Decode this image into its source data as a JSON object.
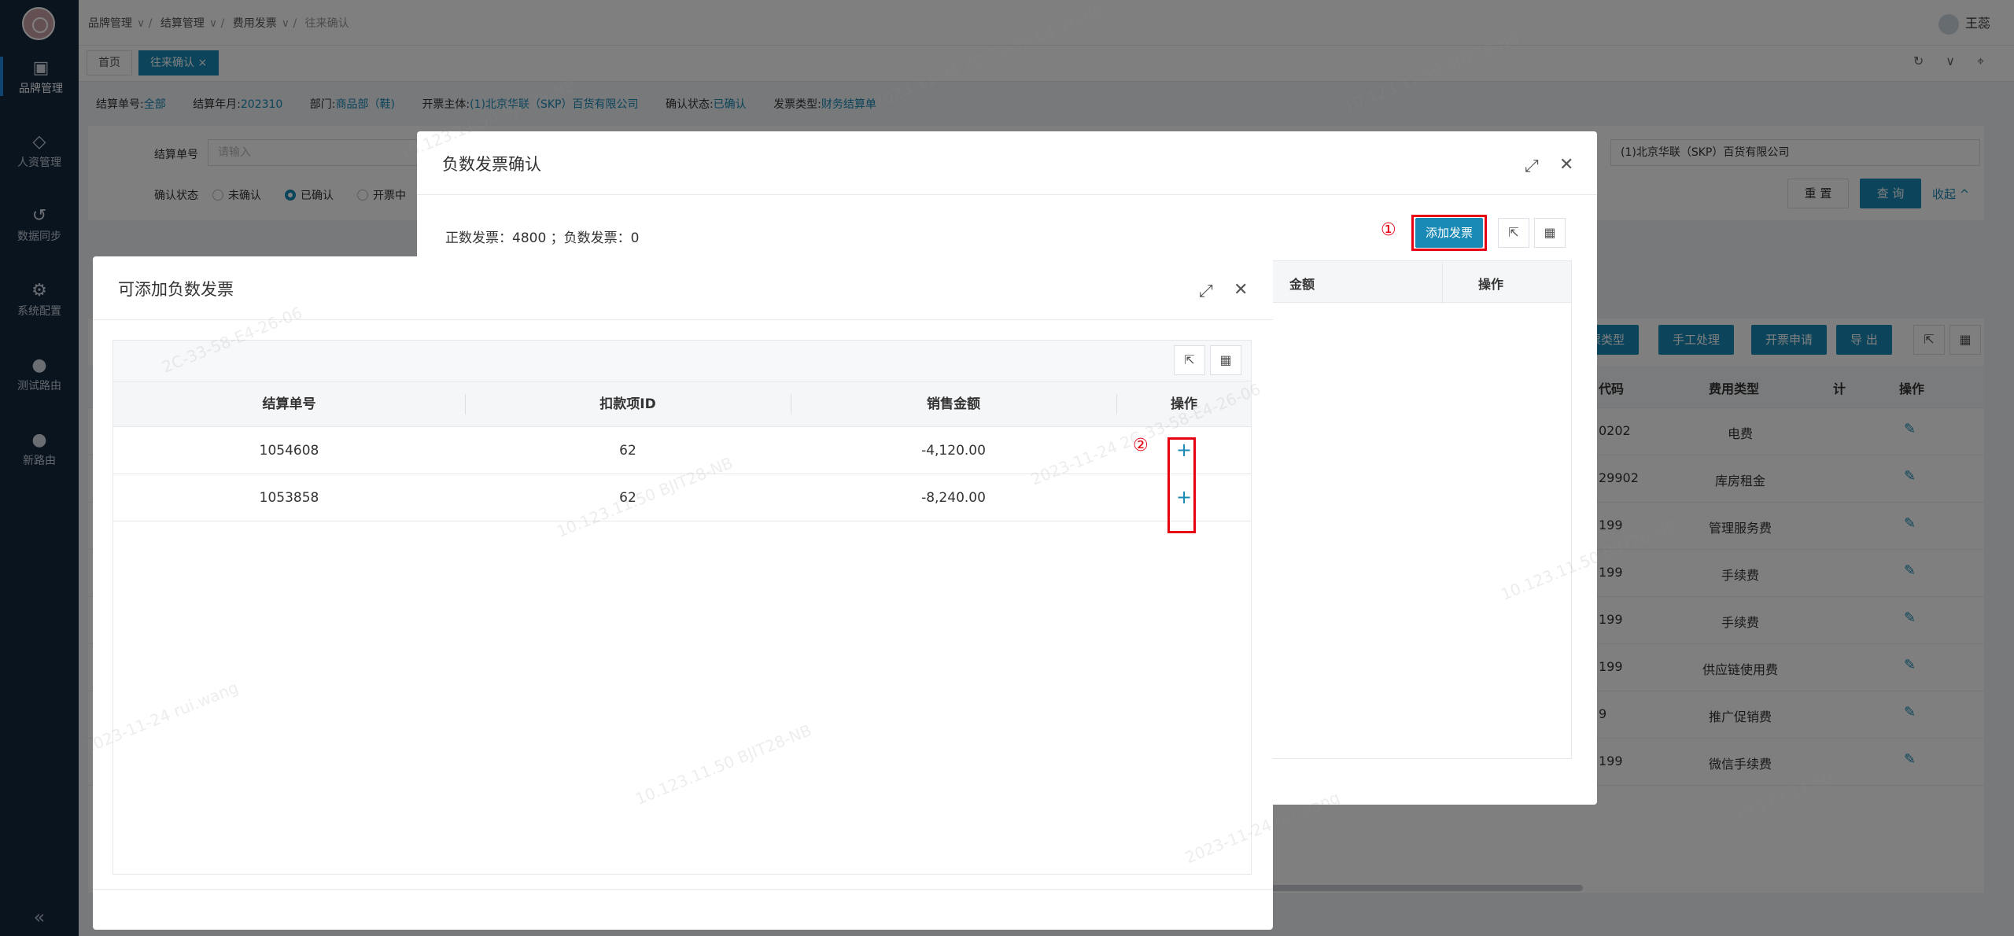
{
  "sidebar": {
    "items": [
      {
        "label": "品牌管理",
        "icon": "store-icon"
      },
      {
        "label": "人资管理",
        "icon": "layers-icon"
      },
      {
        "label": "数据同步",
        "icon": "sync-icon"
      },
      {
        "label": "系统配置",
        "icon": "gear-icon"
      },
      {
        "label": "测试路由",
        "icon": "cat-icon"
      },
      {
        "label": "新路由",
        "icon": "cat-icon"
      }
    ],
    "collapse": "«"
  },
  "breadcrumb": [
    "品牌管理",
    "结算管理",
    "费用发票",
    "往来确认"
  ],
  "user": {
    "name": "王蕊"
  },
  "tabs": [
    {
      "label": "首页"
    },
    {
      "label": "往来确认 ×"
    }
  ],
  "summary": {
    "no_label": "结算单号:",
    "no_val": "全部",
    "ym_label": "结算年月:",
    "ym_val": "202310",
    "dept_label": "部门:",
    "dept_val": "商品部（鞋)",
    "entity_label": "开票主体:",
    "entity_val": "(1)北京华联（SKP）百货有限公司",
    "status_label": "确认状态:",
    "status_val": "已确认",
    "invtype_label": "发票类型:",
    "invtype_val": "财务结算单"
  },
  "search": {
    "no_label": "结算单号",
    "no_placeholder": "请输入",
    "status_label": "确认状态",
    "radios": [
      "未确认",
      "已确认",
      "开票中"
    ],
    "entity_value": "(1)北京华联（SKP）百货有限公司",
    "reset": "重 置",
    "query": "查 询",
    "collapse": "收起 ^"
  },
  "main": {
    "toolbar": [
      "票类型",
      "手工处理",
      "开票申请",
      "导 出"
    ],
    "columns": [
      "代码",
      "费用类型",
      "计",
      "操作"
    ],
    "rows": [
      {
        "code": "0202",
        "type": "电费"
      },
      {
        "code": "29902",
        "type": "库房租金"
      },
      {
        "code": "199",
        "type": "管理服务费"
      },
      {
        "code": "199",
        "type": "手续费"
      },
      {
        "code": "199",
        "type": "手续费"
      },
      {
        "code": "199",
        "type": "供应链使用费"
      },
      {
        "code": "9",
        "type": "推广促销费"
      },
      {
        "code": "199",
        "type": "微信手续费"
      }
    ]
  },
  "dialog1": {
    "title": "负数发票确认",
    "counts": "正数发票：4800 ；负数发票：0",
    "add_button": "添加发票",
    "marker": "①",
    "columns": [
      "金额",
      "操作"
    ]
  },
  "dialog2": {
    "title": "可添加负数发票",
    "marker": "②",
    "columns": [
      "结算单号",
      "扣款项ID",
      "销售金额",
      "操作"
    ],
    "rows": [
      {
        "no": "1054608",
        "deduct_id": "62",
        "amount": "-4,120.00",
        "op": "+"
      },
      {
        "no": "1053858",
        "deduct_id": "62",
        "amount": "-8,240.00",
        "op": "+"
      }
    ]
  },
  "colors": {
    "accent": "#1989b6",
    "highlight": "#e60012",
    "sidebar": "#15293f"
  }
}
